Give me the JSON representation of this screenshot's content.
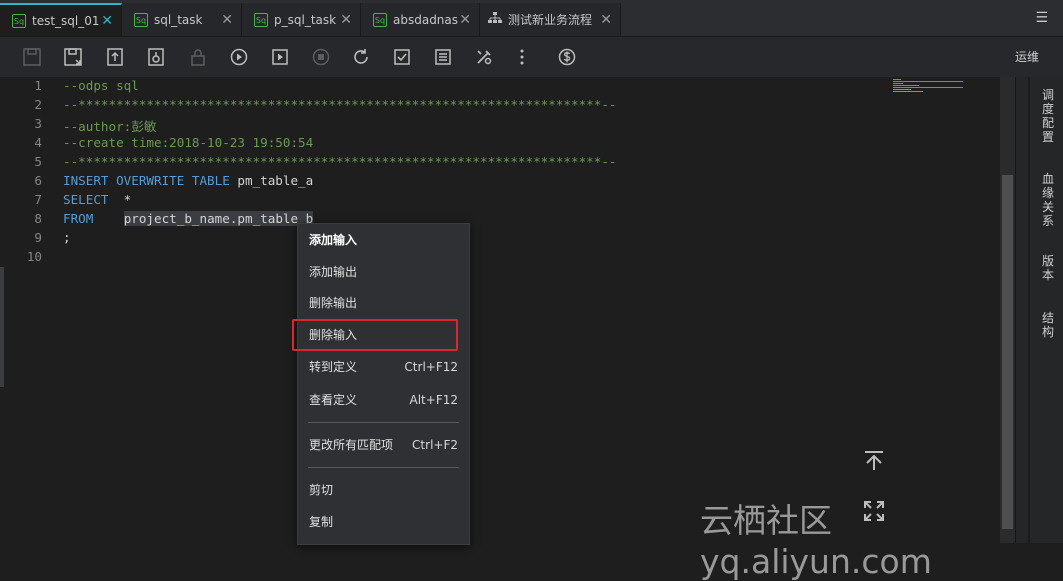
{
  "tabs": [
    {
      "badge": "Sq",
      "label": "test_sql_01",
      "active": true
    },
    {
      "badge": "Sq",
      "label": "sql_task"
    },
    {
      "badge": "Sq",
      "label": "p_sql_task"
    },
    {
      "badge": "Sq",
      "label": "absdadnas"
    },
    {
      "label": "测试新业务流程"
    }
  ],
  "tab_close": "✕",
  "toolbar": {
    "ops_label": "运维"
  },
  "editor": {
    "line_numbers": [
      "1",
      "2",
      "3",
      "4",
      "5",
      "6",
      "7",
      "8",
      "9",
      "10"
    ],
    "lines": [
      "--odps sql",
      "--*********************************************************************--",
      "--author:彭敏",
      "--create time:2018-10-23 19:50:54",
      "--*********************************************************************--",
      "",
      "",
      "",
      ";",
      ""
    ],
    "line6": {
      "kw": "INSERT OVERWRITE TABLE",
      "rest": " pm_table_a"
    },
    "line7": {
      "kw": "SELECT",
      "rest": "  *"
    },
    "line8": {
      "kw": "FROM",
      "pad": "    ",
      "highlight": "project_b_name.pm_table b"
    }
  },
  "right_panel": [
    "调度配置",
    "血缘关系",
    "版本",
    "结构"
  ],
  "context_menu": {
    "items": [
      {
        "label": "添加输入",
        "shortcut": ""
      },
      {
        "label": "添加输出",
        "shortcut": ""
      },
      {
        "label": "删除输出",
        "shortcut": ""
      },
      {
        "label": "删除输入",
        "shortcut": ""
      },
      {
        "label": "转到定义",
        "shortcut": "Ctrl+F12"
      },
      {
        "label": "查看定义",
        "shortcut": "Alt+F12"
      },
      {
        "label": "更改所有匹配项",
        "shortcut": "Ctrl+F2"
      },
      {
        "label": "剪切",
        "shortcut": ""
      },
      {
        "label": "复制",
        "shortcut": ""
      }
    ]
  },
  "watermark": "云栖社区 yq.aliyun.com",
  "colors": {
    "accent": "#2fb5c9",
    "sql_badge": "#45b549",
    "comment": "#6a9955",
    "keyword": "#569cd6",
    "highlight_box": "#d9272e"
  }
}
